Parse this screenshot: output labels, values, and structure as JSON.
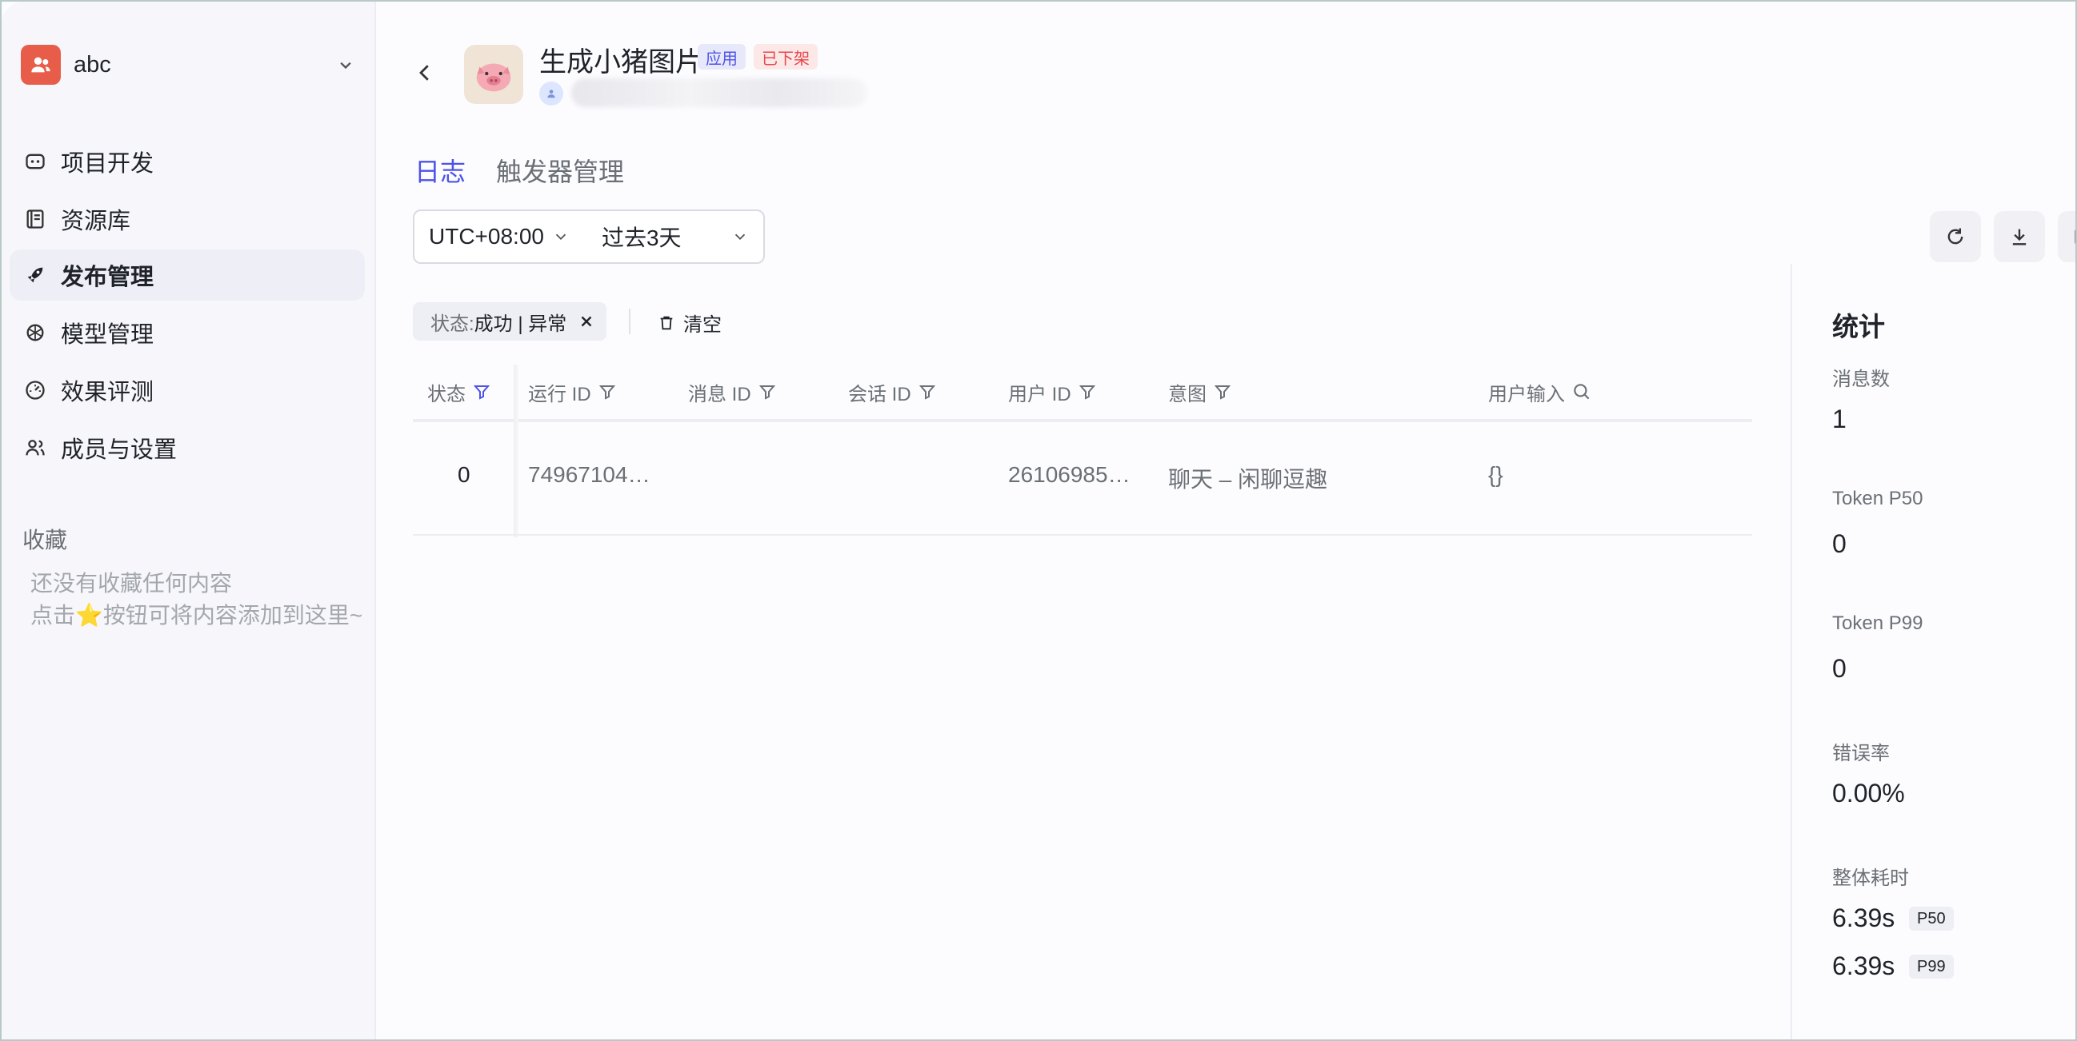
{
  "workspace": {
    "name": "abc"
  },
  "sidebar": {
    "items": [
      {
        "label": "项目开发",
        "icon": "robot-icon"
      },
      {
        "label": "资源库",
        "icon": "library-icon"
      },
      {
        "label": "发布管理",
        "icon": "rocket-icon",
        "active": true
      },
      {
        "label": "模型管理",
        "icon": "model-icon"
      },
      {
        "label": "效果评测",
        "icon": "gauge-icon"
      },
      {
        "label": "成员与设置",
        "icon": "members-icon"
      }
    ],
    "favorites_title": "收藏",
    "favorites_empty_line1": "还没有收藏任何内容",
    "favorites_empty_line2": "点击⭐按钮可将内容添加到这里~"
  },
  "header": {
    "app_title": "生成小猪图片",
    "tag_app": "应用",
    "tag_status": "已下架"
  },
  "tabs": [
    {
      "label": "日志",
      "active": true
    },
    {
      "label": "触发器管理"
    }
  ],
  "filters": {
    "timezone": "UTC+08:00",
    "range": "过去3天",
    "chip_key": "状态: ",
    "chip_value": "成功 | 异常",
    "clear_label": "清空"
  },
  "table": {
    "columns": [
      "状态",
      "运行 ID",
      "消息 ID",
      "会话 ID",
      "用户 ID",
      "意图",
      "用户输入"
    ],
    "rows": [
      {
        "status": "0",
        "run_id": "74967104…",
        "message_id": "",
        "session_id": "",
        "user_id": "26106985…",
        "intent": "聊天 – 闲聊逗趣",
        "user_input": "{}"
      }
    ]
  },
  "stats": {
    "title": "统计",
    "messages_label": "消息数",
    "messages_value": "1",
    "token_p50_label": "Token P50",
    "token_p50_value": "0",
    "token_p99_label": "Token P99",
    "token_p99_value": "0",
    "error_rate_label": "错误率",
    "error_rate_value": "0.00%",
    "latency_label": "整体耗时",
    "latency_p50_value": "6.39s",
    "latency_p50_badge": "P50",
    "latency_p99_value": "6.39s",
    "latency_p99_badge": "P99"
  },
  "colors": {
    "accent": "#4d53e8",
    "danger": "#e5484d",
    "workspace_avatar": "#e85d4a"
  }
}
